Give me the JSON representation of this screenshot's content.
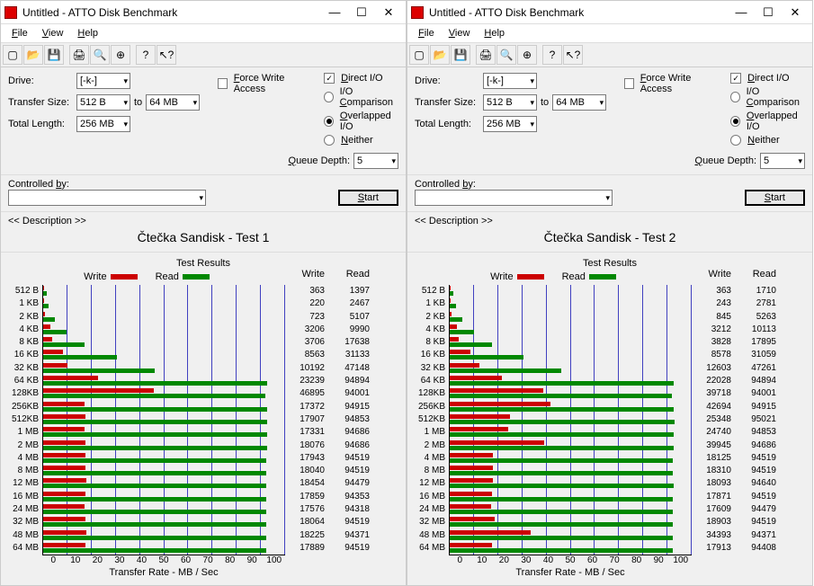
{
  "windows": [
    {
      "title": "Untitled - ATTO Disk Benchmark",
      "menu": [
        "File",
        "View",
        "Help"
      ],
      "drive": "[-k-]",
      "transfer_from": "512 B",
      "transfer_to_label": "to",
      "transfer_to": "64 MB",
      "total_length": "256 MB",
      "force_write": "Force Write Access",
      "direct_io": "Direct I/O",
      "io_comp": "I/O Comparison",
      "overlapped": "Overlapped I/O",
      "neither": "Neither",
      "queue_label": "Queue Depth:",
      "queue": "5",
      "controlled": "Controlled by:",
      "start": "Start",
      "desc_label": "<< Description >>",
      "desc": "Čtečka Sandisk - Test 1",
      "results_label": "Test Results",
      "legend_write": "Write",
      "legend_read": "Read",
      "axis_label": "Transfer Rate - MB / Sec",
      "labels": {
        "drive": "Drive:",
        "transfer": "Transfer Size:",
        "total": "Total Length:"
      }
    },
    {
      "title": "Untitled - ATTO Disk Benchmark",
      "menu": [
        "File",
        "View",
        "Help"
      ],
      "drive": "[-k-]",
      "transfer_from": "512 B",
      "transfer_to_label": "to",
      "transfer_to": "64 MB",
      "total_length": "256 MB",
      "force_write": "Force Write Access",
      "direct_io": "Direct I/O",
      "io_comp": "I/O Comparison",
      "overlapped": "Overlapped I/O",
      "neither": "Neither",
      "queue_label": "Queue Depth:",
      "queue": "5",
      "controlled": "Controlled by:",
      "start": "Start",
      "desc_label": "<< Description >>",
      "desc": "Čtečka Sandisk - Test 2",
      "results_label": "Test Results",
      "legend_write": "Write",
      "legend_read": "Read",
      "axis_label": "Transfer Rate - MB / Sec",
      "labels": {
        "drive": "Drive:",
        "transfer": "Transfer Size:",
        "total": "Total Length:"
      }
    }
  ],
  "chart_data": [
    {
      "type": "bar",
      "title": "Test Results",
      "xlabel": "Transfer Rate - MB / Sec",
      "xlim": [
        0,
        100
      ],
      "xticks": [
        0,
        10,
        20,
        30,
        40,
        50,
        60,
        70,
        80,
        90,
        100
      ],
      "categories": [
        "512 B",
        "1 KB",
        "2 KB",
        "4 KB",
        "8 KB",
        "16 KB",
        "32 KB",
        "64 KB",
        "128KB",
        "256KB",
        "512KB",
        "1 MB",
        "2 MB",
        "4 MB",
        "8 MB",
        "12 MB",
        "16 MB",
        "24 MB",
        "32 MB",
        "48 MB",
        "64 MB"
      ],
      "series": [
        {
          "name": "Write",
          "color": "#cc0000",
          "values": [
            363,
            220,
            723,
            3206,
            3706,
            8563,
            10192,
            23239,
            46895,
            17372,
            17907,
            17331,
            18076,
            17943,
            18040,
            18454,
            17859,
            17576,
            18064,
            18225,
            17889
          ]
        },
        {
          "name": "Read",
          "color": "#008800",
          "values": [
            1397,
            2467,
            5107,
            9990,
            17638,
            31133,
            47148,
            94894,
            94001,
            94915,
            94853,
            94686,
            94686,
            94519,
            94519,
            94479,
            94353,
            94318,
            94519,
            94371,
            94519
          ]
        }
      ],
      "display_scale_kb_to_mb": 1024
    },
    {
      "type": "bar",
      "title": "Test Results",
      "xlabel": "Transfer Rate - MB / Sec",
      "xlim": [
        0,
        100
      ],
      "xticks": [
        0,
        10,
        20,
        30,
        40,
        50,
        60,
        70,
        80,
        90,
        100
      ],
      "categories": [
        "512 B",
        "1 KB",
        "2 KB",
        "4 KB",
        "8 KB",
        "16 KB",
        "32 KB",
        "64 KB",
        "128KB",
        "256KB",
        "512KB",
        "1 MB",
        "2 MB",
        "4 MB",
        "8 MB",
        "12 MB",
        "16 MB",
        "24 MB",
        "32 MB",
        "48 MB",
        "64 MB"
      ],
      "series": [
        {
          "name": "Write",
          "color": "#cc0000",
          "values": [
            363,
            243,
            845,
            3212,
            3828,
            8578,
            12603,
            22028,
            39718,
            42694,
            25348,
            24740,
            39945,
            18125,
            18310,
            18093,
            17871,
            17609,
            18903,
            34393,
            17913
          ]
        },
        {
          "name": "Read",
          "color": "#008800",
          "values": [
            1710,
            2781,
            5263,
            10113,
            17895,
            31059,
            47261,
            94894,
            94001,
            94915,
            95021,
            94853,
            94686,
            94519,
            94519,
            94640,
            94519,
            94479,
            94519,
            94371,
            94408
          ]
        }
      ],
      "display_scale_kb_to_mb": 1024
    }
  ],
  "xticks_display": [
    "0",
    "10",
    "20",
    "30",
    "40",
    "50",
    "60",
    "70",
    "80",
    "90",
    "100"
  ]
}
